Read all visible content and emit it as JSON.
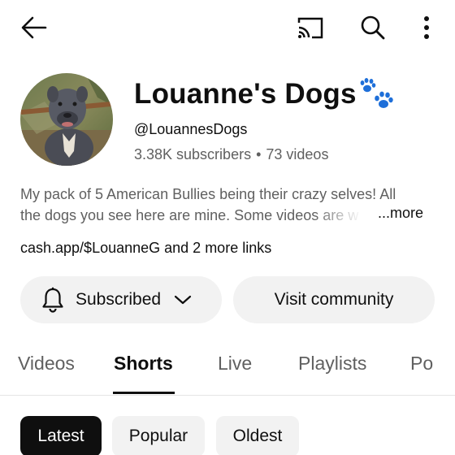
{
  "topbar": {
    "back_icon": "arrow-left-icon",
    "cast_icon": "cast-icon",
    "search_icon": "search-icon",
    "more_icon": "more-vertical-icon"
  },
  "channel": {
    "name": "Louanne's Dogs",
    "name_icon": "paw-prints-icon",
    "handle": "@LouannesDogs",
    "subscribers": "3.38K subscribers",
    "separator": "•",
    "videos": "73 videos",
    "avatar": "avatar-dog-photo",
    "description_line1": "My pack of 5 American Bullies being their crazy selves! All",
    "description_line2": "the dogs you see here are mine. Some videos are w",
    "more_label": "...more",
    "links_text": "cash.app/$LouanneG and 2 more links"
  },
  "actions": {
    "subscribed_label": "Subscribed",
    "bell_icon": "bell-icon",
    "chevron_icon": "chevron-down-icon",
    "community_label": "Visit community"
  },
  "tabs": [
    {
      "label": "Videos",
      "active": false
    },
    {
      "label": "Shorts",
      "active": true
    },
    {
      "label": "Live",
      "active": false
    },
    {
      "label": "Playlists",
      "active": false
    },
    {
      "label": "Po",
      "active": false
    }
  ],
  "chips": [
    {
      "label": "Latest",
      "selected": true
    },
    {
      "label": "Popular",
      "selected": false
    },
    {
      "label": "Oldest",
      "selected": false
    }
  ],
  "colors": {
    "text_primary": "#0f0f0f",
    "text_secondary": "#606060",
    "chip_bg": "#f2f2f2",
    "selected_chip_bg": "#0f0f0f",
    "paw_blue": "#1e6fd9"
  }
}
